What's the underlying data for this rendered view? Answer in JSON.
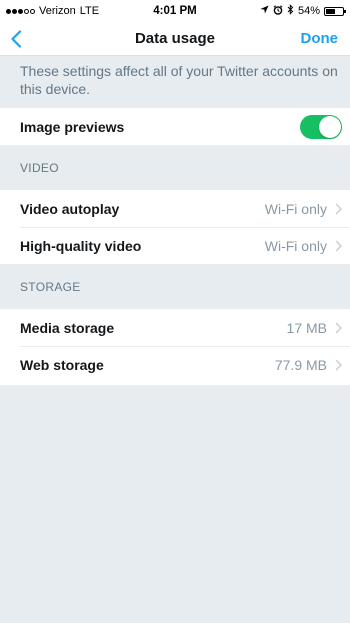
{
  "status_bar": {
    "carrier": "Verizon",
    "network": "LTE",
    "time": "4:01 PM",
    "battery_percent": "54%",
    "battery_level": 0.54
  },
  "nav": {
    "title": "Data usage",
    "done_label": "Done"
  },
  "info_text": "These settings affect all of your Twitter accounts on this device.",
  "image_previews": {
    "label": "Image previews",
    "enabled": true
  },
  "video_section": {
    "header": "VIDEO",
    "rows": [
      {
        "label": "Video autoplay",
        "value": "Wi-Fi only"
      },
      {
        "label": "High-quality video",
        "value": "Wi-Fi only"
      }
    ]
  },
  "storage_section": {
    "header": "STORAGE",
    "rows": [
      {
        "label": "Media storage",
        "value": "17 MB"
      },
      {
        "label": "Web storage",
        "value": "77.9 MB"
      }
    ]
  },
  "colors": {
    "accent": "#1da1f2",
    "toggle_on": "#17bf63",
    "group_background": "#e6ecf0"
  }
}
